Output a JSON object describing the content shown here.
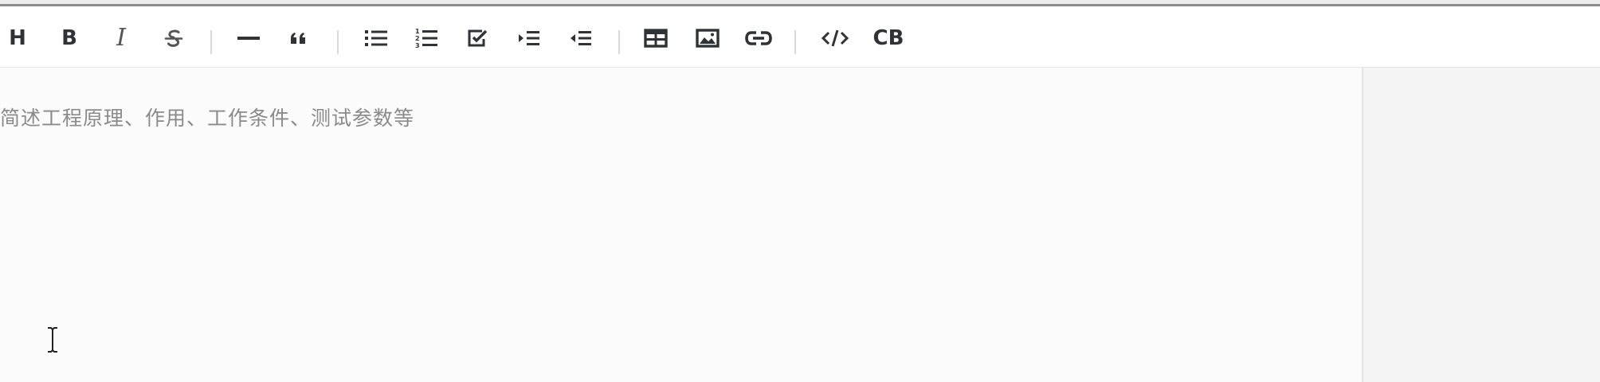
{
  "toolbar": {
    "buttons": [
      {
        "id": "heading",
        "label": "H",
        "icon": "heading-icon"
      },
      {
        "id": "bold",
        "label": "B",
        "icon": "bold-icon"
      },
      {
        "id": "italic",
        "label": "I",
        "icon": "italic-icon"
      },
      {
        "id": "strikethrough",
        "label": "",
        "icon": "strikethrough-icon"
      },
      {
        "id": "horizontal-rule",
        "label": "",
        "icon": "horizontal-rule-icon"
      },
      {
        "id": "quote",
        "label": "",
        "icon": "quote-icon"
      },
      {
        "id": "bullet-list",
        "label": "",
        "icon": "bullet-list-icon"
      },
      {
        "id": "ordered-list",
        "label": "",
        "icon": "ordered-list-icon"
      },
      {
        "id": "task-list",
        "label": "",
        "icon": "task-list-icon"
      },
      {
        "id": "indent",
        "label": "",
        "icon": "indent-icon"
      },
      {
        "id": "outdent",
        "label": "",
        "icon": "outdent-icon"
      },
      {
        "id": "table",
        "label": "",
        "icon": "table-icon"
      },
      {
        "id": "image",
        "label": "",
        "icon": "image-icon"
      },
      {
        "id": "link",
        "label": "",
        "icon": "link-icon"
      },
      {
        "id": "code",
        "label": "",
        "icon": "code-icon"
      },
      {
        "id": "code-block",
        "label": "CB",
        "icon": "code-block-icon"
      }
    ]
  },
  "editor": {
    "placeholder": "简述工程原理、作用、工作条件、测试参数等",
    "value": ""
  },
  "colors": {
    "toolbar_bg": "#ffffff",
    "icon": "#2f3236",
    "placeholder": "#8a8a8a",
    "editor_bg": "#fbfbfb",
    "preview_bg": "#f4f4f4"
  }
}
